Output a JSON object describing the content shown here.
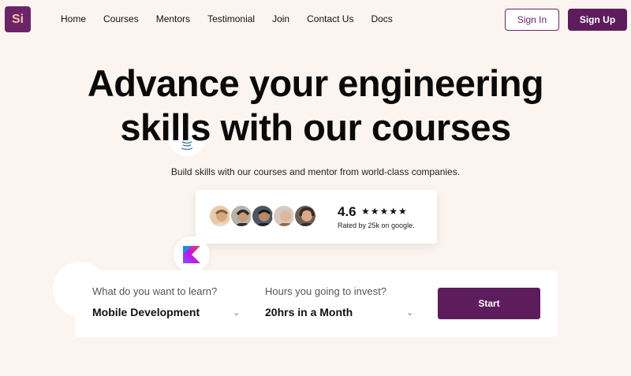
{
  "brand": {
    "logo_text": "Si",
    "color": "#6b2468"
  },
  "nav": {
    "items": [
      "Home",
      "Courses",
      "Mentors",
      "Testimonial",
      "Join",
      "Contact Us",
      "Docs"
    ],
    "signin_label": "Sign In",
    "signup_label": "Sign Up"
  },
  "hero": {
    "title_line1": "Advance your engineering",
    "title_line2": "skills with our courses",
    "subtitle": "Build skills with our courses and mentor from world-class companies."
  },
  "rating": {
    "score": "4.6",
    "stars": 4.5,
    "stars_glyphs": "★★★★★",
    "caption": "Rated by 25k on google."
  },
  "search": {
    "learn_label": "What do you want to learn?",
    "learn_value": "Mobile Development",
    "hours_label": "Hours you going to invest?",
    "hours_value": "20hrs in a Month",
    "start_label": "Start"
  },
  "icons": [
    "java-icon",
    "kotlin-icon",
    "swift-icon",
    "chevron-down-icon"
  ]
}
